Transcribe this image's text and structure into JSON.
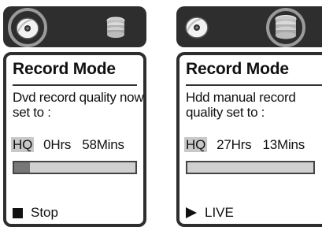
{
  "panels": [
    {
      "title": "Record Mode",
      "message": "Dvd record quality now set to :",
      "quality": "HQ",
      "hours": "0Hrs",
      "mins": "58Mins",
      "progress": 0.13,
      "status": "Stop",
      "status_icon": "stop-icon",
      "selected_source": "dvd"
    },
    {
      "title": "Record Mode",
      "message": "Hdd manual record quality set to :",
      "quality": "HQ",
      "hours": "27Hrs",
      "mins": "13Mins",
      "progress": 0,
      "status": "LIVE",
      "status_icon": "play-icon",
      "selected_source": "hdd"
    }
  ],
  "colors": {
    "frame": "#2e2e2e",
    "highlight_ring": "#9a9a9a",
    "bar_fill": "#777777",
    "bar_bg": "#d0d0d0"
  }
}
